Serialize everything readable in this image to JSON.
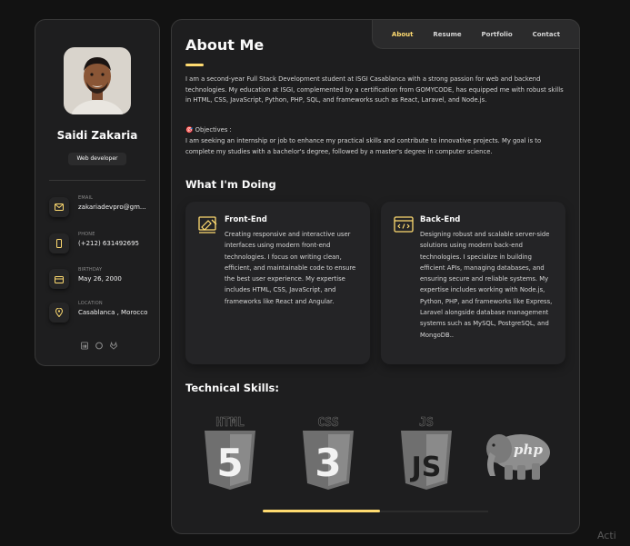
{
  "profile": {
    "name": "Saidi Zakaria",
    "role": "Web developer",
    "avatar_icon": "person-avatar-icon"
  },
  "contacts": [
    {
      "label": "EMAIL",
      "value": "zakariadevpro@gm...",
      "icon": "mail-icon"
    },
    {
      "label": "PHONE",
      "value": "(+212) 631492695",
      "icon": "phone-icon"
    },
    {
      "label": "BIRTHDAY",
      "value": "May 26, 2000",
      "icon": "calendar-icon"
    },
    {
      "label": "LOCATION",
      "value": "Casablanca , Morocco",
      "icon": "location-pin-icon"
    }
  ],
  "social": [
    "linkedin-icon",
    "github-icon",
    "gitlab-icon"
  ],
  "nav": {
    "items": [
      "About",
      "Resume",
      "Portfolio",
      "Contact"
    ],
    "active": "About"
  },
  "about": {
    "title": "About Me",
    "intro": "I am a second-year Full Stack Development student at ISGI Casablanca with a strong passion for web and backend technologies. My education at ISGI, complemented by a certification from GOMYCODE, has equipped me with robust skills in HTML, CSS, JavaScript, Python, PHP, SQL, and frameworks such as React, Laravel, and Node.js.",
    "objectives_label": "🎯 Objectives :",
    "objectives": "I am seeking an internship or job to enhance my practical skills and contribute to innovative projects. My goal is to complete my studies with a bachelor's degree, followed by a master's degree in computer science."
  },
  "services": {
    "title": "What I'm Doing",
    "items": [
      {
        "title": "Front-End",
        "icon": "design-icon",
        "text": "Creating responsive and interactive user interfaces using modern front-end technologies. I focus on writing clean, efficient, and maintainable code to ensure the best user experience. My expertise includes HTML, CSS, JavaScript, and frameworks like React and Angular."
      },
      {
        "title": "Back-End",
        "icon": "code-window-icon",
        "text": "Designing robust and scalable server-side solutions using modern back-end technologies. I specialize in building efficient APIs, managing databases, and ensuring secure and reliable systems. My expertise includes working with Node.js, Python, PHP, and frameworks like Express, Laravel alongside database management systems such as MySQL, PostgreSQL, and MongoDB.."
      }
    ]
  },
  "skills": {
    "title": "Technical Skills:",
    "logos": [
      {
        "label": "HTML",
        "glyph": "5",
        "icon": "html5-logo"
      },
      {
        "label": "CSS",
        "glyph": "3",
        "icon": "css3-logo"
      },
      {
        "label": "JS",
        "glyph": "JS",
        "icon": "js-logo"
      },
      {
        "label": "php",
        "icon": "php-elephant-logo"
      }
    ],
    "scroll_progress": 0.52
  },
  "colors": {
    "accent": "#ffdb70",
    "background": "#121212",
    "card": "#1e1e1f"
  },
  "watermark": "Acti"
}
